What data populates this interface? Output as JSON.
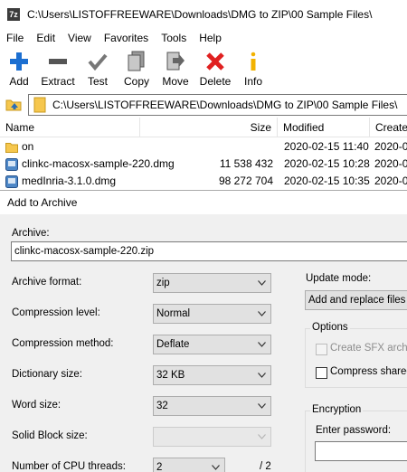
{
  "window": {
    "title": "C:\\Users\\LISTOFFREEWARE\\Downloads\\DMG to ZIP\\00 Sample Files\\",
    "app_icon_text": "7z"
  },
  "menu": [
    "File",
    "Edit",
    "View",
    "Favorites",
    "Tools",
    "Help"
  ],
  "toolbar": {
    "add": "Add",
    "extract": "Extract",
    "test": "Test",
    "copy": "Copy",
    "move": "Move",
    "delete": "Delete",
    "info": "Info"
  },
  "address": {
    "path": "C:\\Users\\LISTOFFREEWARE\\Downloads\\DMG to ZIP\\00 Sample Files\\"
  },
  "filelist": {
    "headers": {
      "name": "Name",
      "size": "Size",
      "modified": "Modified",
      "created": "Created"
    },
    "rows": [
      {
        "name": "on",
        "size": "",
        "modified": "2020-02-15 11:40",
        "created": "2020-0",
        "icon": "folder-icon"
      },
      {
        "name": "clinkc-macosx-sample-220.dmg",
        "size": "11 538 432",
        "modified": "2020-02-15 10:28",
        "created": "2020-0",
        "icon": "disk-image-icon"
      },
      {
        "name": "medInria-3.1.0.dmg",
        "size": "98 272 704",
        "modified": "2020-02-15 10:35",
        "created": "2020-0",
        "icon": "disk-image-icon"
      }
    ]
  },
  "dialog": {
    "title": "Add to Archive",
    "archive_label": "Archive:",
    "archive_value": "clinkc-macosx-sample-220.zip",
    "format_label": "Archive format:",
    "format_value": "zip",
    "level_label": "Compression level:",
    "level_value": "Normal",
    "method_label": "Compression method:",
    "method_value": "Deflate",
    "dict_label": "Dictionary size:",
    "dict_value": "32 KB",
    "word_label": "Word size:",
    "word_value": "32",
    "solid_label": "Solid Block size:",
    "solid_value": "",
    "threads_label": "Number of CPU threads:",
    "threads_value": "2",
    "threads_total": "/ 2",
    "update_label": "Update mode:",
    "update_value": "Add and replace files",
    "options_title": "Options",
    "sfx_label": "Create SFX archiv",
    "shared_label": "Compress shared f",
    "encryption_title": "Encryption",
    "password_label": "Enter password:",
    "password_value": ""
  },
  "colors": {
    "add_icon": "#1c6fd1",
    "delete_icon": "#e02020",
    "info_icon": "#f2b200",
    "folder": "#f6c74e"
  }
}
